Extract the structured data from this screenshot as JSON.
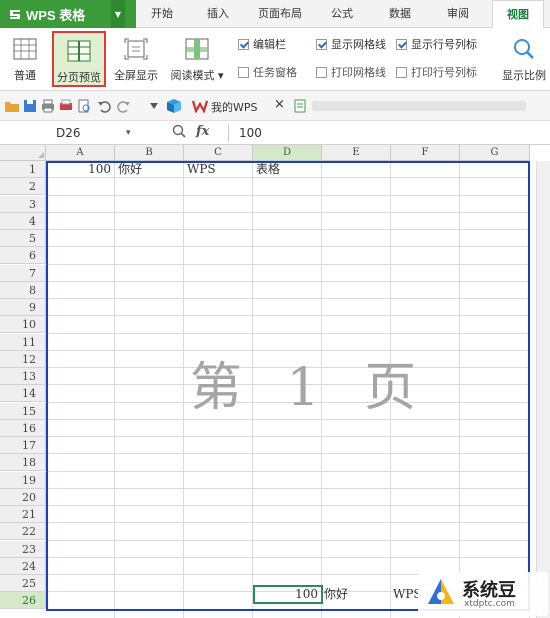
{
  "menubar": {
    "app_name": "WPS 表格",
    "tabs": [
      {
        "label": "开始"
      },
      {
        "label": "插入"
      },
      {
        "label": "页面布局"
      },
      {
        "label": "公式"
      },
      {
        "label": "数据"
      },
      {
        "label": "审阅"
      },
      {
        "label": "视图"
      }
    ],
    "active_tab": "视图"
  },
  "ribbon": {
    "buttons": [
      {
        "label": "普通"
      },
      {
        "label": "分页预览",
        "selected": true
      },
      {
        "label": "全屏显示"
      },
      {
        "label": "阅读模式",
        "has_dropdown": true
      },
      {
        "label": "显示比例"
      }
    ],
    "checks": [
      {
        "label": "编辑栏",
        "checked": true
      },
      {
        "label": "任务窗格",
        "checked": false
      },
      {
        "label": "显示网格线",
        "checked": true
      },
      {
        "label": "打印网格线",
        "checked": false
      },
      {
        "label": "显示行号列标",
        "checked": true
      },
      {
        "label": "打印行号列标",
        "checked": false
      }
    ]
  },
  "qat": {
    "mywps_label": "我的WPS",
    "close_glyph": "×"
  },
  "formula_bar": {
    "cell_ref": "D26",
    "fx": "fx",
    "value": "100"
  },
  "grid": {
    "columns": [
      "A",
      "B",
      "C",
      "D",
      "E",
      "F",
      "G"
    ],
    "rows": [
      "1",
      "2",
      "3",
      "4",
      "5",
      "6",
      "7",
      "8",
      "9",
      "10",
      "11",
      "12",
      "13",
      "14",
      "15",
      "16",
      "17",
      "18",
      "19",
      "20",
      "21",
      "22",
      "23",
      "24",
      "25",
      "26"
    ],
    "selected_column": "D",
    "selected_row": "26",
    "row1": {
      "A": "100",
      "B": "你好",
      "C": "WPS",
      "D": "表格"
    },
    "row26": {
      "D": "100",
      "E": "你好",
      "F": "WPS"
    },
    "page_label": "第 1 页"
  },
  "watermark": {
    "title": "系统豆",
    "url": "xtdptc.com"
  },
  "colors": {
    "app_green": "#3b9b3b",
    "page_border": "#1d3fbf",
    "selected_highlight": "#e23a3a"
  }
}
